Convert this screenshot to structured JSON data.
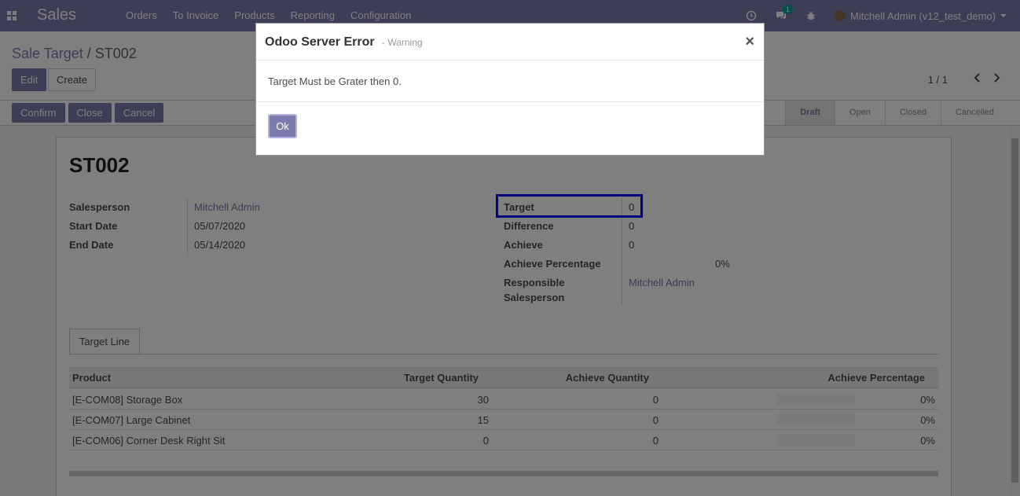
{
  "navbar": {
    "app_name": "Sales",
    "menu": [
      "Orders",
      "To Invoice",
      "Products",
      "Reporting",
      "Configuration"
    ],
    "messages_count": "1",
    "user": "Mitchell Admin (v12_test_demo)"
  },
  "control": {
    "breadcrumb_parent": "Sale Target",
    "breadcrumb_sep": "/",
    "breadcrumb_current": "ST002",
    "edit_label": "Edit",
    "create_label": "Create",
    "pager": "1 / 1"
  },
  "status": {
    "buttons": [
      "Confirm",
      "Close",
      "Cancel"
    ],
    "stages": [
      "Draft",
      "Open",
      "Closed",
      "Cancelled"
    ],
    "active_stage": "Draft"
  },
  "form": {
    "name": "ST002",
    "left": [
      {
        "label": "Salesperson",
        "value": "Mitchell Admin"
      },
      {
        "label": "Start Date",
        "value": "05/07/2020"
      },
      {
        "label": "End Date",
        "value": "05/14/2020"
      }
    ],
    "right": [
      {
        "label": "Target",
        "value": "0"
      },
      {
        "label": "Difference",
        "value": "0"
      },
      {
        "label": "Achieve",
        "value": "0"
      },
      {
        "label": "Achieve Percentage",
        "value": "0%"
      },
      {
        "label": "Responsible",
        "label2": "Salesperson",
        "value": "Mitchell Admin"
      }
    ],
    "tab": "Target Line",
    "columns": [
      "Product",
      "Target Quantity",
      "Achieve Quantity",
      "Achieve Percentage"
    ],
    "rows": [
      {
        "product": "[E-COM08] Storage Box",
        "target": "30",
        "achieve": "0",
        "pct": "0%"
      },
      {
        "product": "[E-COM07] Large Cabinet",
        "target": "15",
        "achieve": "0",
        "pct": "0%"
      },
      {
        "product": "[E-COM06] Corner Desk Right Sit",
        "target": "0",
        "achieve": "0",
        "pct": "0%"
      }
    ]
  },
  "dialog": {
    "title": "Odoo Server Error",
    "subtitle": "- Warning",
    "close": "×",
    "message": "Target Must be Grater then 0.",
    "ok_label": "Ok"
  },
  "colors": {
    "brand": "#7c7bad",
    "highlight": "#0000ff"
  }
}
